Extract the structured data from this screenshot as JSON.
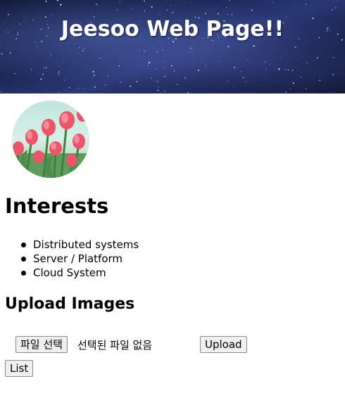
{
  "header": {
    "title": "Jeesoo Web Page!!"
  },
  "interests": {
    "heading": "Interests",
    "items": [
      {
        "label": "Distributed systems"
      },
      {
        "label": "Server / Platform"
      },
      {
        "label": "Cloud System"
      }
    ]
  },
  "upload": {
    "heading": "Upload Images",
    "file_button_label": "파일 선택",
    "file_status": "선택된 파일 없음",
    "upload_button_label": "Upload"
  },
  "list_button_label": "List",
  "colors": {
    "header_bg": "#1c2757",
    "header_text": "#ffffff",
    "button_bg": "#efefef"
  },
  "icons": {
    "avatar_image": "tulip-photo"
  }
}
